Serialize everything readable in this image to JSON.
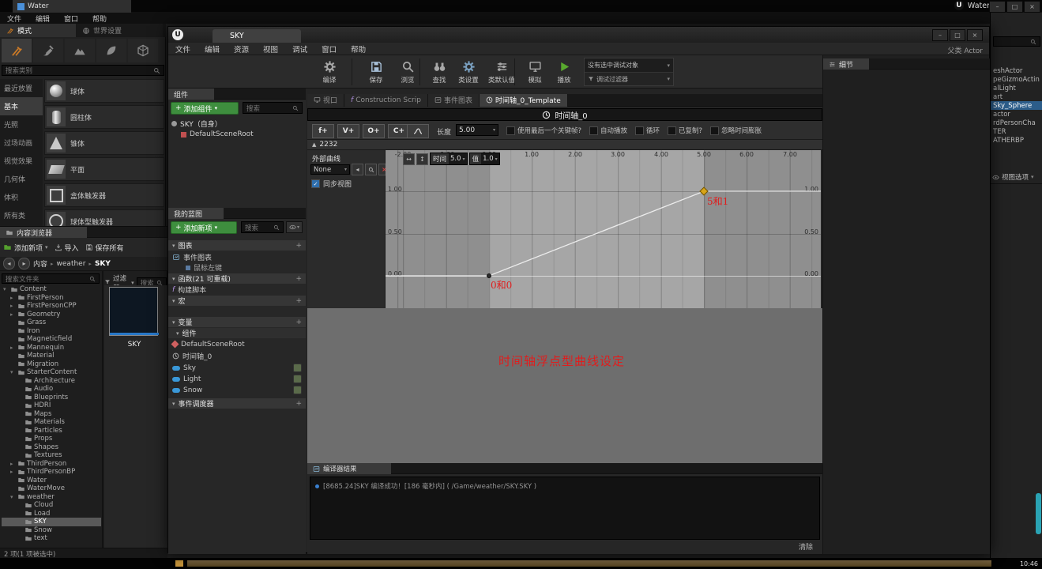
{
  "main_window": {
    "top_tab": "Water",
    "app_title": "Water",
    "menu": [
      {
        "label": "文件"
      },
      {
        "label": "编辑"
      },
      {
        "label": "窗口"
      },
      {
        "label": "帮助"
      }
    ]
  },
  "modes_panel": {
    "tabs": [
      {
        "label": "模式",
        "active": true
      },
      {
        "label": "世界设置"
      }
    ],
    "search_placeholder": "搜索类别",
    "categories": [
      {
        "label": "最近放置"
      },
      {
        "label": "基本",
        "active": true
      },
      {
        "label": "光照"
      },
      {
        "label": "过场动画"
      },
      {
        "label": "视觉效果"
      },
      {
        "label": "几何体"
      },
      {
        "label": "体积"
      },
      {
        "label": "所有类"
      }
    ],
    "place_items": [
      {
        "label": "球体",
        "sphere": true
      },
      {
        "label": "圆柱体",
        "cylinder": true
      },
      {
        "label": "锥体",
        "cone": true
      },
      {
        "label": "平面",
        "plane": true
      },
      {
        "label": "盒体触发器",
        "boxtrigger": true
      },
      {
        "label": "球体型触发器",
        "spheretrigger": true
      }
    ]
  },
  "content_browser": {
    "title": "内容浏览器",
    "add_new_label": "添加新项",
    "import_label": "导入",
    "save_all_label": "保存所有",
    "breadcrumb": [
      {
        "label": "内容"
      },
      {
        "label": "weather"
      },
      {
        "label": "SKY"
      }
    ],
    "folder_search_placeholder": "搜索文件夹",
    "filter_label": "过滤器",
    "asset_search_placeholder": "搜索 SKY",
    "tree": [
      {
        "label": "Content",
        "indent": 0,
        "arrow": "▾"
      },
      {
        "label": "FirstPerson",
        "indent": 1,
        "arrow": "▸"
      },
      {
        "label": "FirstPersonCPP",
        "indent": 1,
        "arrow": "▸"
      },
      {
        "label": "Geometry",
        "indent": 1,
        "arrow": "▸"
      },
      {
        "label": "Grass",
        "indent": 1,
        "arrow": ""
      },
      {
        "label": "Iron",
        "indent": 1,
        "arrow": ""
      },
      {
        "label": "Magneticfield",
        "indent": 1,
        "arrow": ""
      },
      {
        "label": "Mannequin",
        "indent": 1,
        "arrow": "▸"
      },
      {
        "label": "Material",
        "indent": 1,
        "arrow": ""
      },
      {
        "label": "Migration",
        "indent": 1,
        "arrow": ""
      },
      {
        "label": "StarterContent",
        "indent": 1,
        "arrow": "▾"
      },
      {
        "label": "Architecture",
        "indent": 2,
        "arrow": ""
      },
      {
        "label": "Audio",
        "indent": 2,
        "arrow": ""
      },
      {
        "label": "Blueprints",
        "indent": 2,
        "arrow": ""
      },
      {
        "label": "HDRI",
        "indent": 2,
        "arrow": ""
      },
      {
        "label": "Maps",
        "indent": 2,
        "arrow": ""
      },
      {
        "label": "Materials",
        "indent": 2,
        "arrow": ""
      },
      {
        "label": "Particles",
        "indent": 2,
        "arrow": ""
      },
      {
        "label": "Props",
        "indent": 2,
        "arrow": ""
      },
      {
        "label": "Shapes",
        "indent": 2,
        "arrow": ""
      },
      {
        "label": "Textures",
        "indent": 2,
        "arrow": ""
      },
      {
        "label": "ThirdPerson",
        "indent": 1,
        "arrow": "▸"
      },
      {
        "label": "ThirdPersonBP",
        "indent": 1,
        "arrow": "▸"
      },
      {
        "label": "Water",
        "indent": 1,
        "arrow": ""
      },
      {
        "label": "WaterMove",
        "indent": 1,
        "arrow": ""
      },
      {
        "label": "weather",
        "indent": 1,
        "arrow": "▾"
      },
      {
        "label": "Cloud",
        "indent": 2,
        "arrow": ""
      },
      {
        "label": "Load",
        "indent": 2,
        "arrow": ""
      },
      {
        "label": "SKY",
        "indent": 2,
        "arrow": "",
        "selected": true
      },
      {
        "label": "Snow",
        "indent": 2,
        "arrow": ""
      },
      {
        "label": "text",
        "indent": 2,
        "arrow": ""
      }
    ],
    "asset_name": "SKY",
    "status_text": "2 项(1 项被选中)"
  },
  "outliner": {
    "rows": [
      {
        "label": "eshActor"
      },
      {
        "label": "peGizmoActin"
      },
      {
        "label": "alLight"
      },
      {
        "label": "art"
      },
      {
        "label": "Sky_Sphere",
        "selected": true
      },
      {
        "label": "actor"
      },
      {
        "label": "rdPersonCha"
      },
      {
        "label": "TER"
      },
      {
        "label": "ATHERBP"
      }
    ],
    "view_options_label": "视图选项"
  },
  "blueprint": {
    "window_tab": "SKY",
    "menu": [
      {
        "label": "文件"
      },
      {
        "label": "编辑"
      },
      {
        "label": "资源"
      },
      {
        "label": "视图"
      },
      {
        "label": "调试"
      },
      {
        "label": "窗口"
      },
      {
        "label": "帮助"
      }
    ],
    "parent_class": "父类 Actor",
    "toolbar": [
      {
        "label": "编译"
      },
      {
        "label": "保存"
      },
      {
        "label": "浏览"
      },
      {
        "label": "查找"
      },
      {
        "label": "类设置"
      },
      {
        "label": "类默认值"
      },
      {
        "label": "模拟"
      },
      {
        "label": "播放"
      }
    ],
    "debug_dropdown": "没有选中调试对象",
    "debug_filter": "调试过滤器",
    "components": {
      "title": "组件",
      "add_label": "添加组件",
      "search_placeholder": "搜索",
      "rows": [
        {
          "label": "SKY（自身）"
        },
        {
          "label": "DefaultSceneRoot"
        }
      ]
    },
    "my_blueprint": {
      "title": "我的蓝图",
      "add_label": "添加新项",
      "search_placeholder": "搜索",
      "rows": [
        {
          "label": "图表"
        },
        {
          "label": "事件图表"
        },
        {
          "label": "鼠标左键"
        },
        {
          "label": "函数(21 可重载)"
        },
        {
          "label": "构建脚本"
        },
        {
          "label": "宏"
        },
        {
          "label": "变量"
        },
        {
          "label": "组件"
        },
        {
          "label": "DefaultSceneRoot"
        },
        {
          "label": "时间轴_0"
        },
        {
          "label": "Sky"
        },
        {
          "label": "Light"
        },
        {
          "label": "Snow"
        },
        {
          "label": "事件调度器"
        }
      ]
    },
    "doc_tabs": [
      {
        "label": "视口"
      },
      {
        "label": "Construction Scrip"
      },
      {
        "label": "事件图表"
      },
      {
        "label": "时间轴_0_Template",
        "active": true
      }
    ],
    "details_title": "细节",
    "timeline": {
      "title": "时间轴_0",
      "add_track_buttons": [
        {
          "label": "f+"
        },
        {
          "label": "V+"
        },
        {
          "label": "O+"
        },
        {
          "label": "C+"
        }
      ],
      "length_label": "长度",
      "length_value": "5.00",
      "options": [
        {
          "label": "使用最后一个关键帧?"
        },
        {
          "label": "自动播放"
        },
        {
          "label": "循环"
        },
        {
          "label": "已复制?"
        },
        {
          "label": "忽略时间膨胀"
        }
      ],
      "track_name": "2232",
      "external_curve_label": "外部曲线",
      "curve_asset_value": "None",
      "sync_view_label": "同步视图",
      "key_time_label": "时间",
      "key_time_value": "5.0",
      "key_value_label": "值",
      "key_value_value": "1.0",
      "x_ticks": [
        "-2.00",
        "-1.00",
        "0.00",
        "1.00",
        "2.00",
        "3.00",
        "4.00",
        "5.00",
        "6.00",
        "7.00"
      ],
      "y_ticks_left": [
        "1.00",
        "0.50",
        "0.00"
      ],
      "y_ticks_right": [
        "1.00",
        "0.50",
        "0.00"
      ],
      "keys": [
        {
          "time": 0,
          "value": 0,
          "label": "0和0"
        },
        {
          "time": 5,
          "value": 1,
          "label": "5和1",
          "selected": true
        }
      ],
      "annotation": "时间轴浮点型曲线设定"
    },
    "compiler": {
      "tab_label": "编译器结果",
      "message": "[8685.24]SKY 编译成功！[186 毫秒内] ( /Game/weather/SKY.SKY )",
      "clear_label": "清除"
    }
  },
  "taskbar": {
    "clock": "10:46"
  }
}
